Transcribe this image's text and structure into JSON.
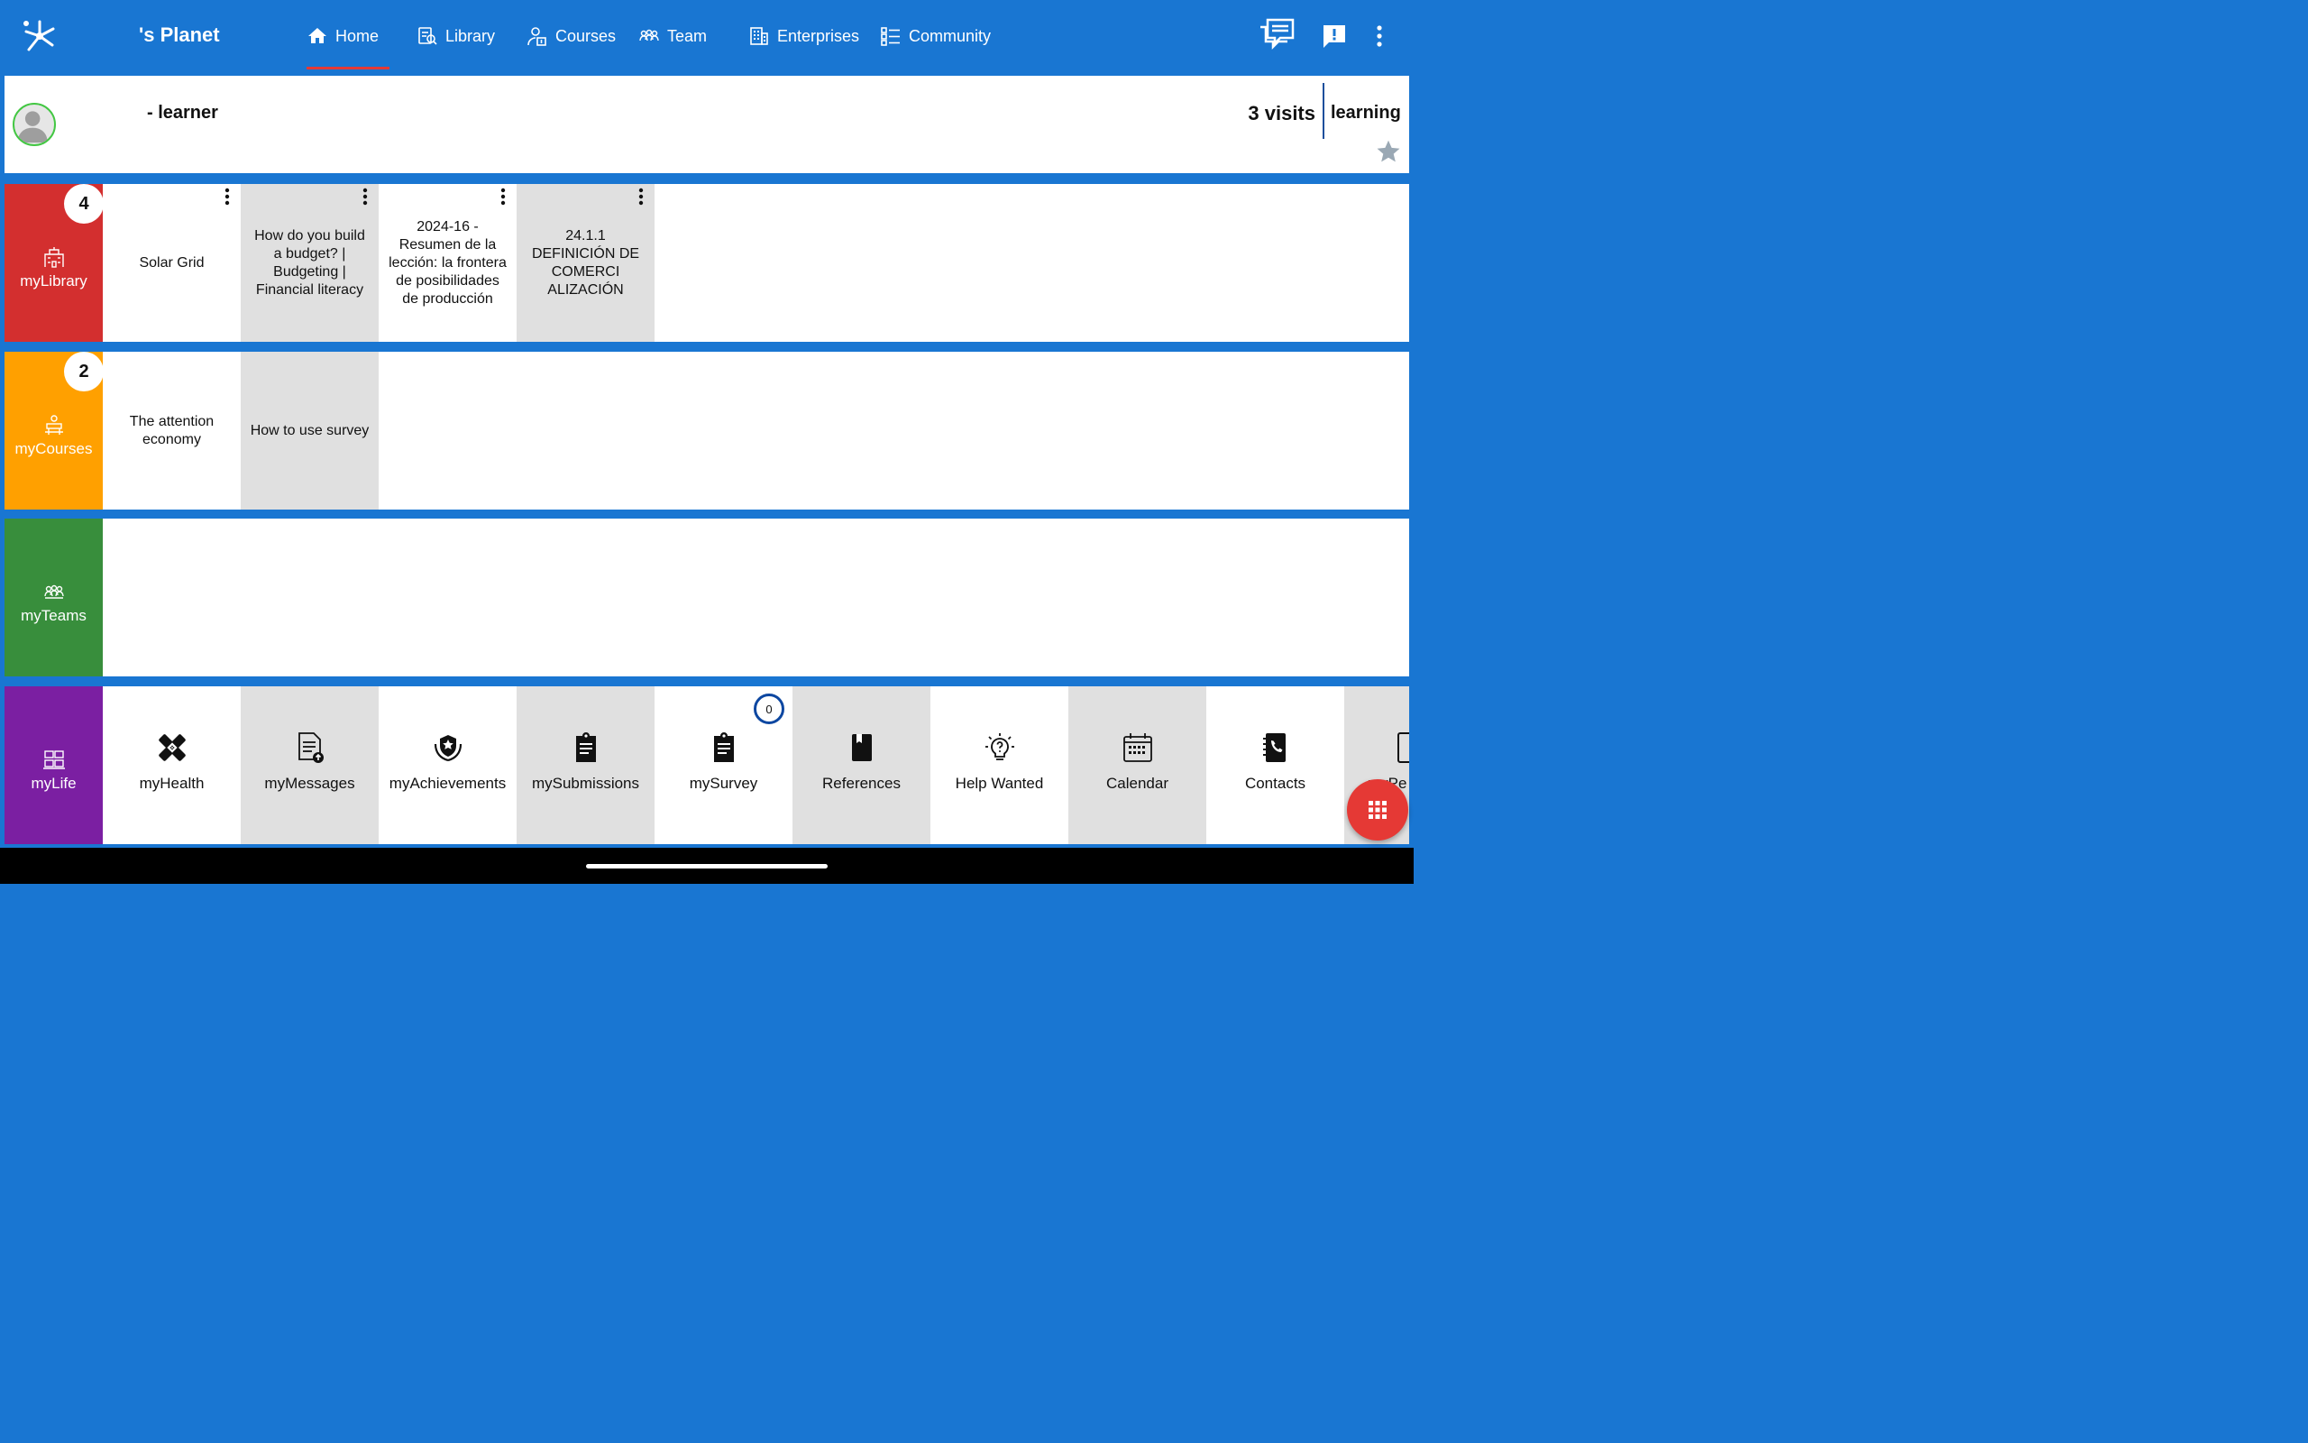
{
  "app": {
    "title": "'s Planet"
  },
  "nav": [
    {
      "label": "Home",
      "icon": "home-icon"
    },
    {
      "label": "Library",
      "icon": "library-icon"
    },
    {
      "label": "Courses",
      "icon": "courses-icon"
    },
    {
      "label": "Team",
      "icon": "team-icon"
    },
    {
      "label": "Enterprises",
      "icon": "building-icon"
    },
    {
      "label": "Community",
      "icon": "checklist-icon"
    }
  ],
  "profile": {
    "name": "- learner",
    "visits": "3 visits",
    "role": "learning"
  },
  "myLibrary": {
    "label": "myLibrary",
    "count": "4",
    "items": [
      "Solar Grid",
      "How do you build a budget? | Budgeting | Financial literacy",
      "2024-16 - Resumen de la lección: la frontera de posibilidades de producción",
      "24.1.1 DEFINICIÓN DE COMERCI ALIZACIÓN"
    ]
  },
  "myCourses": {
    "label": "myCourses",
    "count": "2",
    "items": [
      "The attention economy",
      "How to use survey"
    ]
  },
  "myTeams": {
    "label": "myTeams"
  },
  "myLife": {
    "label": "myLife",
    "survey_count": "0",
    "items": [
      "myHealth",
      "myMessages",
      "myAchievements",
      "mySubmissions",
      "mySurvey",
      "References",
      "Help Wanted",
      "Calendar",
      "Contacts",
      "myPe"
    ]
  },
  "colors": {
    "primary": "#1976D2",
    "library": "#D32F2F",
    "courses": "#FFA000",
    "teams": "#388E3C",
    "life": "#7B1FA2",
    "fab": "#E53935"
  }
}
